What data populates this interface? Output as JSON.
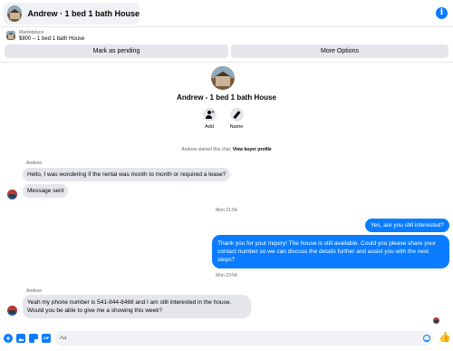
{
  "header": {
    "title": "Andrew · 1 bed 1 bath House",
    "info_icon": "info-icon"
  },
  "marketplace": {
    "label": "Marketplace",
    "listing": "$800 – 1 bed 1 bath House"
  },
  "actions_bar": {
    "pending_label": "Mark as pending",
    "more_label": "More Options"
  },
  "chat_header": {
    "title": "Andrew - 1 bed 1 bath House",
    "add_label": "Add",
    "name_label": "Name"
  },
  "started": {
    "text": "Andrew started this chat.",
    "link": "View buyer profile"
  },
  "messages": [
    {
      "sender": "Andrew",
      "text": "Hello, I was wondering if the rental was month to month or required a lease?"
    },
    {
      "text": "Message sent"
    },
    {
      "timestamp": "Mon 21:54"
    },
    {
      "text": "Yes, are you still interested?"
    },
    {
      "text": "Thank you for your inquiry! The house is still available. Could you please share your contact number so we can discuss the details further and assist you with the next steps?"
    },
    {
      "timestamp": "Mon 23:54"
    },
    {
      "sender": "Andrew",
      "text": "Yeah my phone number is 541-844-8468 and I am still interested in the house. Would you be able to give me a showing this week?"
    }
  ],
  "composer": {
    "placeholder": "Aa"
  },
  "colors": {
    "accent": "#0a7cff",
    "bubble_in": "#e4e6eb",
    "secondary_text": "#65676b"
  }
}
